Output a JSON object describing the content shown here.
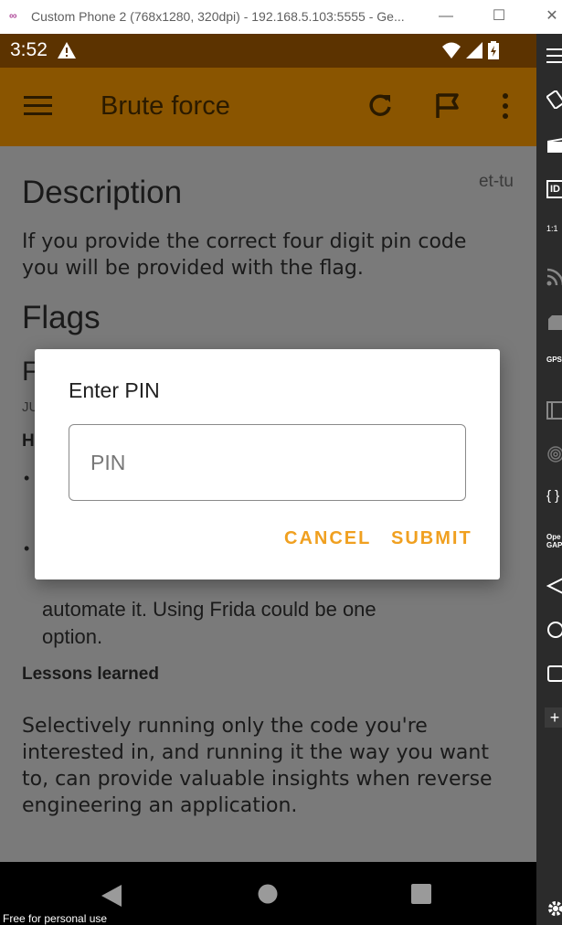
{
  "window": {
    "title": "Custom Phone 2 (768x1280, 320dpi) - 192.168.5.103:5555 - Ge...",
    "minimize": "—",
    "maximize": "☐",
    "close": "✕"
  },
  "statusbar": {
    "time": "3:52"
  },
  "appbar": {
    "title": "Brute force"
  },
  "content": {
    "author": "et-tu",
    "description_heading": "Description",
    "description_text": "If you provide the correct four digit pin code you will be provided with the flag.",
    "flags_heading": "Flags",
    "hidden_heading_fragment": "F",
    "hidden_small_fragment": "JU",
    "hidden_sub_fragment": "H",
    "bullet_1": "•",
    "bullet_2": "•",
    "obscured_line": "automate it. Using Frida could be one",
    "option_line": "option.",
    "lessons_heading": "Lessons learned",
    "lessons_text": "Selectively running only the code you're interested in, and running it the way you want to, can provide valuable insights when reverse engineering an application."
  },
  "dialog": {
    "title": "Enter PIN",
    "input_placeholder": "PIN",
    "input_value": "",
    "cancel_label": "CANCEL",
    "submit_label": "SUBMIT"
  },
  "sidetool": {
    "id_label": "ID",
    "ratio_label": "1:1",
    "gps_label": "GPS",
    "code_label": "{ }",
    "opengapps_label": "Ope GAP",
    "plus_label": "+"
  },
  "footer": {
    "note": "Free for personal use"
  },
  "colors": {
    "accent": "#f0a020",
    "appbar": "#8a5500",
    "statusbar": "#5c3300",
    "scrim_content": "#7a7a7a"
  }
}
